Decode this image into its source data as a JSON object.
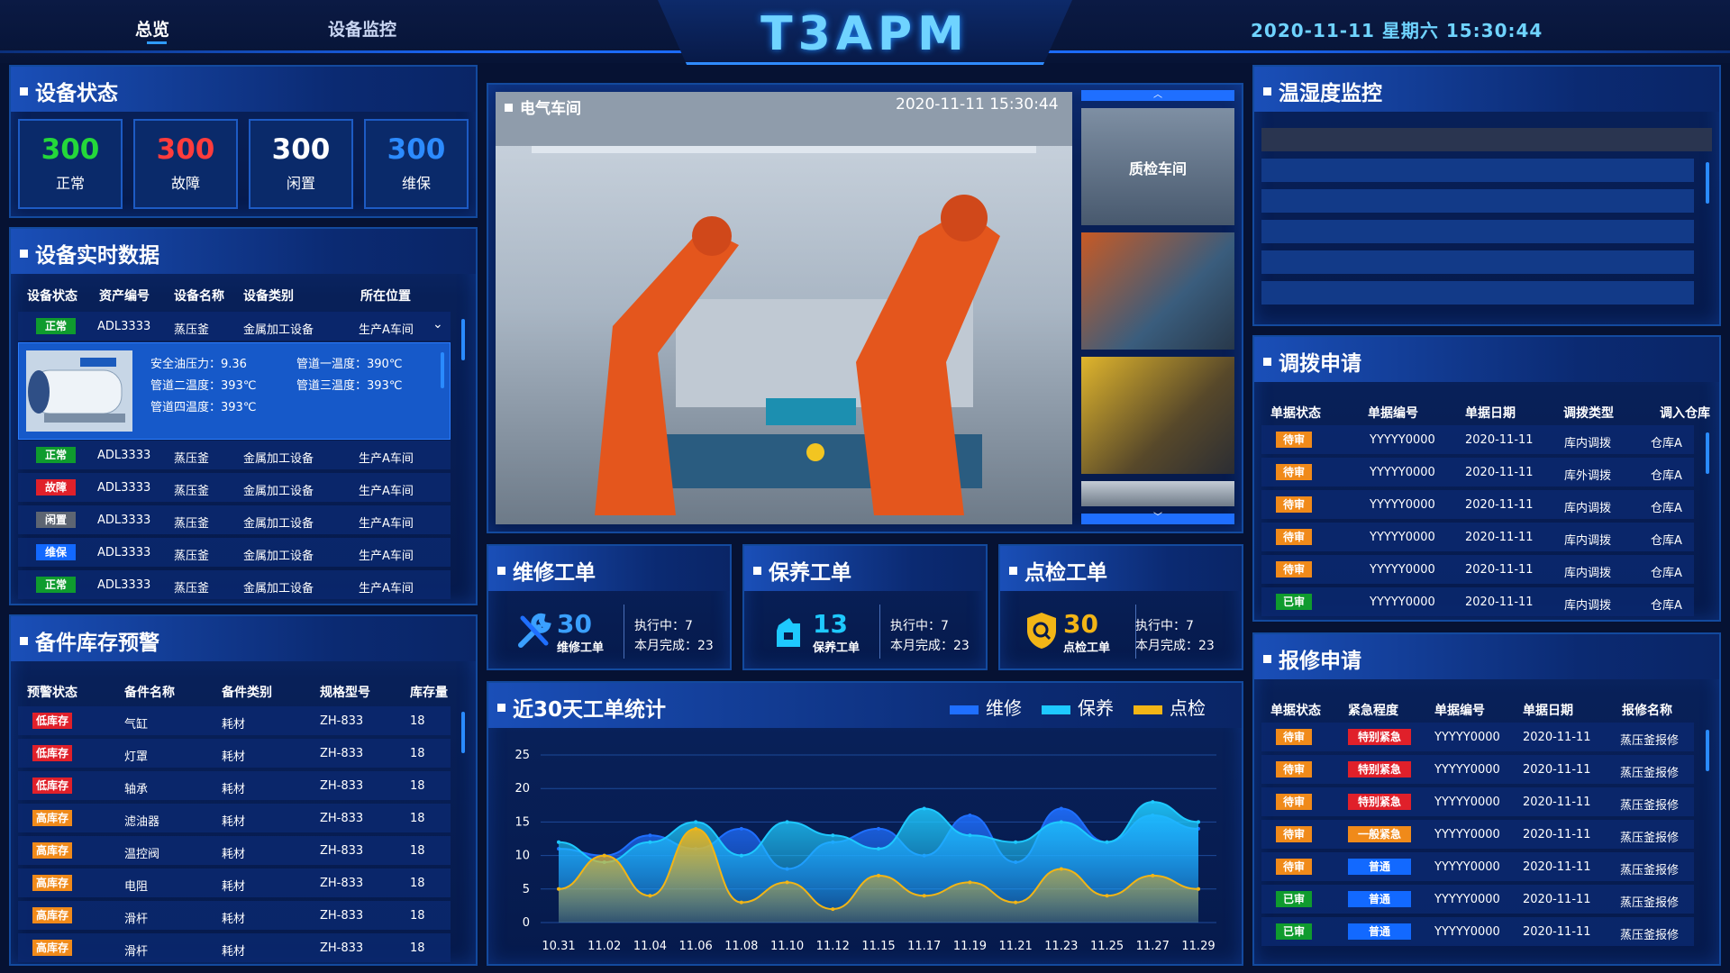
{
  "header": {
    "title": "T3APM",
    "nav": [
      "总览",
      "设备监控"
    ],
    "datetime": "2020-11-11 星期六 15:30:44"
  },
  "device_status": {
    "title": "设备状态",
    "items": [
      {
        "value": "300",
        "label": "正常",
        "color": "#24d83a"
      },
      {
        "value": "300",
        "label": "故障",
        "color": "#ff3c3c"
      },
      {
        "value": "300",
        "label": "闲置",
        "color": "#ffffff"
      },
      {
        "value": "300",
        "label": "维保",
        "color": "#2c8bff"
      }
    ]
  },
  "realtime": {
    "title": "设备实时数据",
    "columns": [
      "设备状态",
      "资产编号",
      "设备名称",
      "设备类别",
      "所在位置"
    ],
    "rows": [
      {
        "status": "正常",
        "status_color": "green",
        "id": "ADL3333",
        "name": "蒸压釜",
        "category": "金属加工设备",
        "location": "生产A车间"
      },
      {
        "status": "正常",
        "status_color": "green",
        "id": "ADL3333",
        "name": "蒸压釜",
        "category": "金属加工设备",
        "location": "生产A车间"
      },
      {
        "status": "故障",
        "status_color": "red",
        "id": "ADL3333",
        "name": "蒸压釜",
        "category": "金属加工设备",
        "location": "生产A车间"
      },
      {
        "status": "闲置",
        "status_color": "gray",
        "id": "ADL3333",
        "name": "蒸压釜",
        "category": "金属加工设备",
        "location": "生产A车间"
      },
      {
        "status": "维保",
        "status_color": "blue",
        "id": "ADL3333",
        "name": "蒸压釜",
        "category": "金属加工设备",
        "location": "生产A车间"
      },
      {
        "status": "正常",
        "status_color": "green",
        "id": "ADL3333",
        "name": "蒸压釜",
        "category": "金属加工设备",
        "location": "生产A车间"
      }
    ],
    "detail": {
      "lines": [
        "安全油压力：9.36",
        "管道一温度：390℃",
        "管道二温度：393℃",
        "管道三温度：393℃",
        "管道四温度：393℃"
      ]
    }
  },
  "spare_parts": {
    "title": "备件库存预警",
    "columns": [
      "预警状态",
      "备件名称",
      "备件类别",
      "规格型号",
      "库存量"
    ],
    "rows": [
      {
        "status": "低库存",
        "color": "red",
        "name": "气缸",
        "category": "耗材",
        "model": "ZH-833",
        "qty": "18"
      },
      {
        "status": "低库存",
        "color": "red",
        "name": "灯罩",
        "category": "耗材",
        "model": "ZH-833",
        "qty": "18"
      },
      {
        "status": "低库存",
        "color": "red",
        "name": "轴承",
        "category": "耗材",
        "model": "ZH-833",
        "qty": "18"
      },
      {
        "status": "高库存",
        "color": "orange",
        "name": "滤油器",
        "category": "耗材",
        "model": "ZH-833",
        "qty": "18"
      },
      {
        "status": "高库存",
        "color": "orange",
        "name": "温控阀",
        "category": "耗材",
        "model": "ZH-833",
        "qty": "18"
      },
      {
        "status": "高库存",
        "color": "orange",
        "name": "电阻",
        "category": "耗材",
        "model": "ZH-833",
        "qty": "18"
      },
      {
        "status": "高库存",
        "color": "orange",
        "name": "滑杆",
        "category": "耗材",
        "model": "ZH-833",
        "qty": "18"
      },
      {
        "status": "高库存",
        "color": "orange",
        "name": "滑杆",
        "category": "耗材",
        "model": "ZH-833",
        "qty": "18"
      }
    ]
  },
  "video": {
    "label": "电气车间",
    "timestamp": "2020-11-11 15:30:44",
    "thumbs": [
      "质检车间"
    ]
  },
  "work_orders": [
    {
      "title": "维修工单",
      "count": "30",
      "sub": "维修工单",
      "running": "执行中：7",
      "done": "本月完成：23",
      "icon": "wrench-icon"
    },
    {
      "title": "保养工单",
      "count": "13",
      "sub": "保养工单",
      "running": "执行中：7",
      "done": "本月完成：23",
      "icon": "oil-can-icon"
    },
    {
      "title": "点检工单",
      "count": "30",
      "sub": "点检工单",
      "running": "执行中：7",
      "done": "本月完成：23",
      "icon": "shield-search-icon"
    }
  ],
  "chart_data": {
    "type": "area",
    "title": "近30天工单统计",
    "x": [
      "10.31",
      "11.02",
      "11.04",
      "11.06",
      "11.08",
      "11.10",
      "11.12",
      "11.15",
      "11.17",
      "11.19",
      "11.21",
      "11.23",
      "11.25",
      "11.27",
      "11.29"
    ],
    "ylim": [
      0,
      25
    ],
    "yticks": [
      "25",
      "20",
      "15",
      "10",
      "5",
      "0"
    ],
    "series": [
      {
        "name": "维修",
        "color": "#1f6fff",
        "values": [
          11,
          10,
          13,
          11,
          14,
          8,
          12,
          14,
          10,
          16,
          9,
          17,
          12,
          16,
          14
        ]
      },
      {
        "name": "保养",
        "color": "#1ec9ff",
        "values": [
          12,
          9,
          12,
          15,
          10,
          15,
          13,
          11,
          17,
          13,
          12,
          15,
          12,
          18,
          15
        ]
      },
      {
        "name": "点检",
        "color": "#f2b516",
        "values": [
          5,
          10,
          4,
          14,
          3,
          6,
          2,
          7,
          4,
          6,
          3,
          8,
          4,
          7,
          5
        ]
      }
    ]
  },
  "temp_humidity": {
    "title": "温湿度监控"
  },
  "transfer": {
    "title": "调拨申请",
    "columns": [
      "单据状态",
      "单据编号",
      "单据日期",
      "调拨类型",
      "调入仓库"
    ],
    "rows": [
      {
        "status": "待审",
        "color": "orange",
        "no": "YYYYY0000",
        "date": "2020-11-11",
        "type": "库内调拨",
        "to": "仓库A"
      },
      {
        "status": "待审",
        "color": "orange",
        "no": "YYYYY0000",
        "date": "2020-11-11",
        "type": "库外调拨",
        "to": "仓库A"
      },
      {
        "status": "待审",
        "color": "orange",
        "no": "YYYYY0000",
        "date": "2020-11-11",
        "type": "库内调拨",
        "to": "仓库A"
      },
      {
        "status": "待审",
        "color": "orange",
        "no": "YYYYY0000",
        "date": "2020-11-11",
        "type": "库内调拨",
        "to": "仓库A"
      },
      {
        "status": "待审",
        "color": "orange",
        "no": "YYYYY0000",
        "date": "2020-11-11",
        "type": "库内调拨",
        "to": "仓库A"
      },
      {
        "status": "已审",
        "color": "green",
        "no": "YYYYY0000",
        "date": "2020-11-11",
        "type": "库内调拨",
        "to": "仓库A"
      }
    ]
  },
  "repair": {
    "title": "报修申请",
    "columns": [
      "单据状态",
      "紧急程度",
      "单据编号",
      "单据日期",
      "报修名称"
    ],
    "rows": [
      {
        "status": "待审",
        "color": "orange",
        "level": "特别紧急",
        "level_color": "red",
        "no": "YYYYY0000",
        "date": "2020-11-11",
        "name": "蒸压釜报修"
      },
      {
        "status": "待审",
        "color": "orange",
        "level": "特别紧急",
        "level_color": "red",
        "no": "YYYYY0000",
        "date": "2020-11-11",
        "name": "蒸压釜报修"
      },
      {
        "status": "待审",
        "color": "orange",
        "level": "特别紧急",
        "level_color": "red",
        "no": "YYYYY0000",
        "date": "2020-11-11",
        "name": "蒸压釜报修"
      },
      {
        "status": "待审",
        "color": "orange",
        "level": "一般紧急",
        "level_color": "orange",
        "no": "YYYYY0000",
        "date": "2020-11-11",
        "name": "蒸压釜报修"
      },
      {
        "status": "待审",
        "color": "orange",
        "level": "普通",
        "level_color": "blue",
        "no": "YYYYY0000",
        "date": "2020-11-11",
        "name": "蒸压釜报修"
      },
      {
        "status": "已审",
        "color": "green",
        "level": "普通",
        "level_color": "blue",
        "no": "YYYYY0000",
        "date": "2020-11-11",
        "name": "蒸压釜报修"
      },
      {
        "status": "已审",
        "color": "green",
        "level": "普通",
        "level_color": "blue",
        "no": "YYYYY0000",
        "date": "2020-11-11",
        "name": "蒸压釜报修"
      }
    ]
  }
}
